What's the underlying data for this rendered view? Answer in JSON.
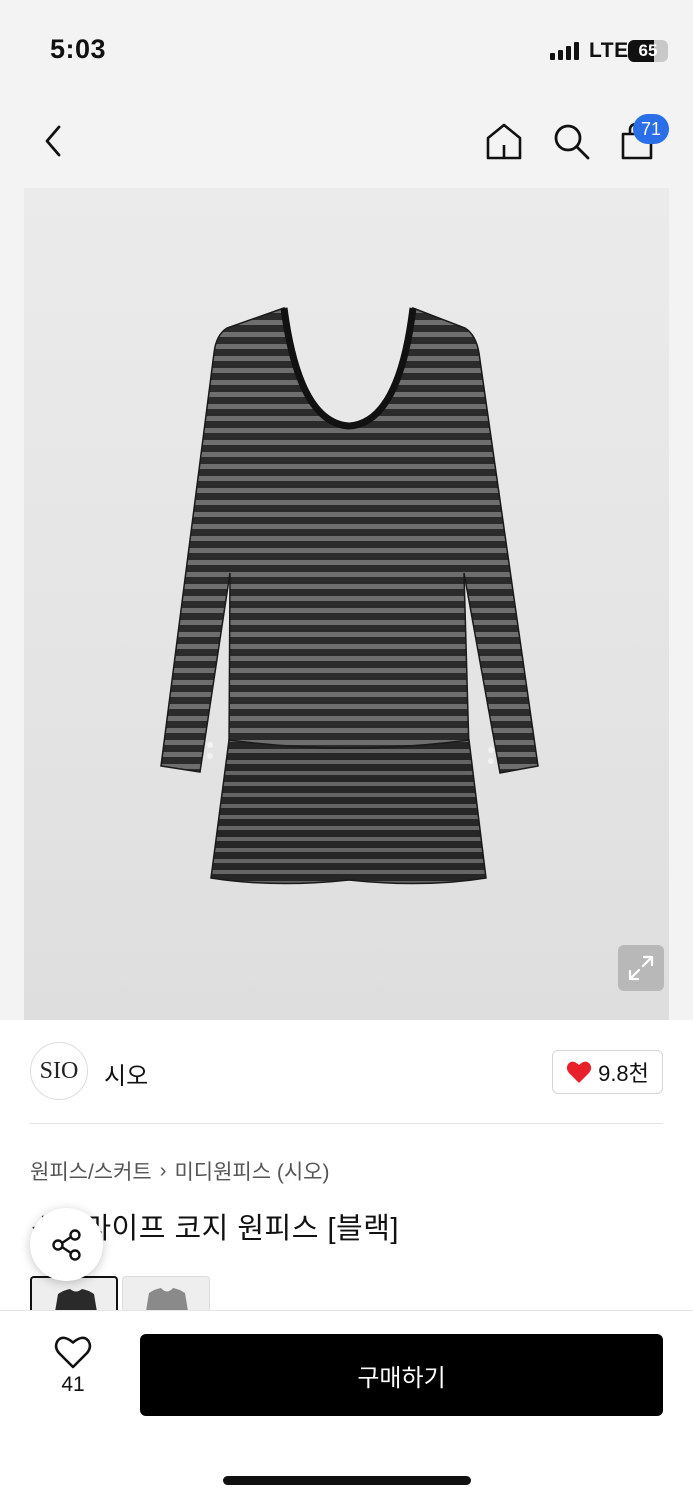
{
  "status_bar": {
    "time": "5:03",
    "network": "LTE",
    "battery": "65",
    "battery_level": 0.65
  },
  "nav": {
    "cart_count": "71",
    "icons": [
      "chevron-left-icon",
      "home-icon",
      "search-icon",
      "shopping-bag-icon"
    ]
  },
  "brand": {
    "logo_text": "SIO",
    "name": "시오",
    "like_count": "9.8천"
  },
  "breadcrumb": {
    "category": "원피스/스커트",
    "subcategory": "미디원피스 (시오)"
  },
  "product": {
    "title": "스트라이프 코지 원피스 [블랙]"
  },
  "bottom_bar": {
    "wish_count": "41",
    "buy_label": "구매하기"
  },
  "colors": {
    "badge": "#2a6fe8",
    "heart": "#e8202a",
    "buy_button": "#000000"
  }
}
